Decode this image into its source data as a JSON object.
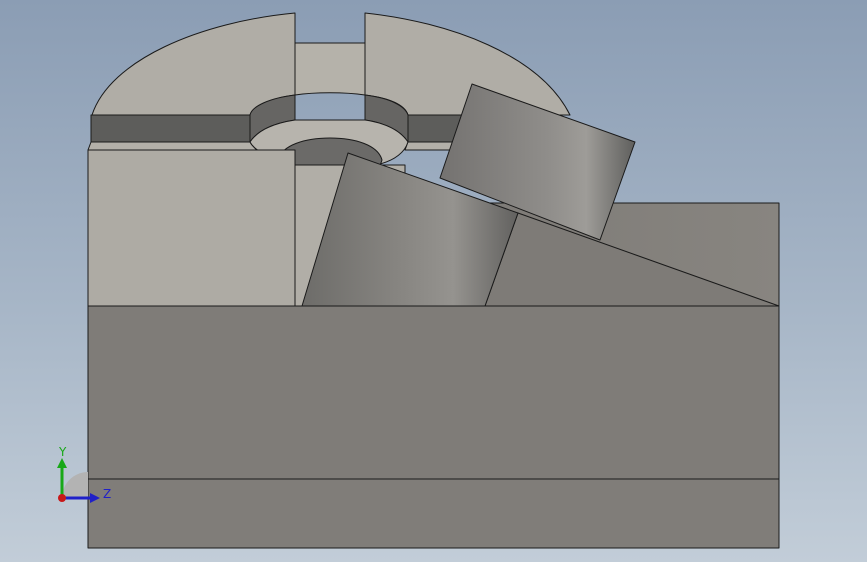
{
  "viewport": {
    "background_top": "#8b9db4",
    "background_bottom": "#c2cdd8"
  },
  "model": {
    "colors": {
      "top_face": "#b0ada6",
      "front_face": "#aeaba4",
      "slot_face": "#5d5d5b",
      "base_block": "#7f7c78",
      "side_face": "#7a7874",
      "cylinder_light": "#9c9a96",
      "cylinder_dark": "#5e5e5c",
      "edge": "#1a1a1a"
    }
  },
  "triad": {
    "y_label": "Y",
    "z_label": "Z",
    "y_color": "#18a818",
    "z_color": "#2020c8",
    "x_color": "#c81818"
  }
}
